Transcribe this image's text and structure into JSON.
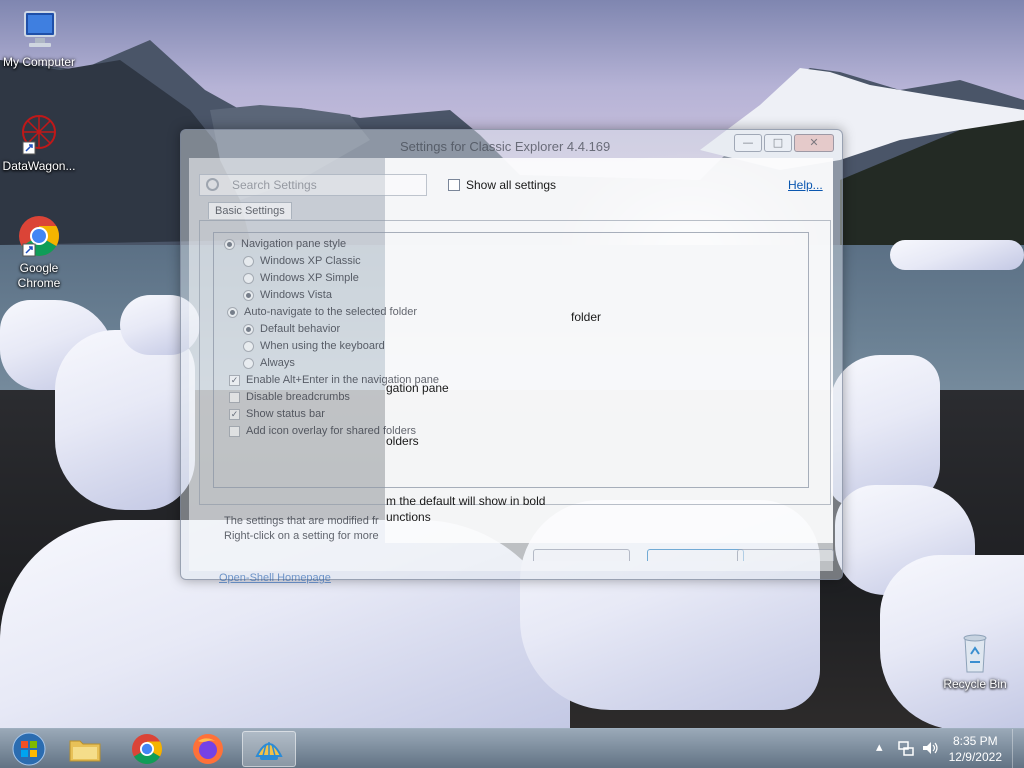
{
  "desktop": {
    "icons": [
      {
        "label": "My Computer",
        "icon": "computer-icon"
      },
      {
        "label": "DataWagon...",
        "icon": "datawagon-icon"
      },
      {
        "label": "Google Chrome",
        "icon": "chrome-icon"
      },
      {
        "label": "Recycle Bin",
        "icon": "recycle-bin-icon"
      }
    ]
  },
  "window": {
    "title": "Settings for Classic Explorer 4.4.169",
    "controls": {
      "minimize": "—",
      "maximize": "□",
      "close": "✕"
    },
    "search_placeholder": "Search Settings",
    "show_all_label": "Show all settings",
    "show_all_checked": false,
    "help_label": "Help...",
    "tab_label": "Basic Settings",
    "tree": [
      {
        "type": "radio",
        "label": "Navigation pane style",
        "checked": true,
        "level": 0
      },
      {
        "type": "radio",
        "label": "Windows XP Classic",
        "checked": false,
        "level": 1
      },
      {
        "type": "radio",
        "label": "Windows XP Simple",
        "checked": false,
        "level": 1
      },
      {
        "type": "radio",
        "label": "Windows Vista",
        "checked": true,
        "level": 1
      },
      {
        "type": "radio",
        "label": "Auto-navigate to the selected folder",
        "checked": true,
        "level": 0
      },
      {
        "type": "radio",
        "label": "Default behavior",
        "checked": true,
        "level": 1
      },
      {
        "type": "radio",
        "label": "When using the keyboard",
        "checked": false,
        "level": 1
      },
      {
        "type": "radio",
        "label": "Always",
        "checked": false,
        "level": 1
      },
      {
        "type": "check",
        "label": "Enable Alt+Enter in the navigation pane",
        "checked": true,
        "level": 0
      },
      {
        "type": "check",
        "label": "Disable breadcrumbs",
        "checked": false,
        "level": 0
      },
      {
        "type": "check",
        "label": "Show status bar",
        "checked": true,
        "level": 0
      },
      {
        "type": "check",
        "label": "Add icon overlay for shared folders",
        "checked": false,
        "level": 0
      }
    ],
    "right_fragments": {
      "row5": "folder",
      "row9": "gation pane",
      "row12": "olders",
      "status1": "m the default will show in bold",
      "status2": "unctions"
    },
    "status_line1": "The settings that are modified fr",
    "status_line2": "Right-click on a setting for more",
    "homepage_link": "Open-Shell Homepage"
  },
  "taskbar": {
    "apps": [
      {
        "name": "start",
        "icon": "windows-start-icon"
      },
      {
        "name": "explorer",
        "icon": "folder-icon"
      },
      {
        "name": "chrome",
        "icon": "chrome-icon"
      },
      {
        "name": "firefox",
        "icon": "firefox-icon"
      },
      {
        "name": "open-shell",
        "icon": "shell-icon",
        "active": true
      }
    ],
    "time": "8:35 PM",
    "date": "12/9/2022"
  }
}
